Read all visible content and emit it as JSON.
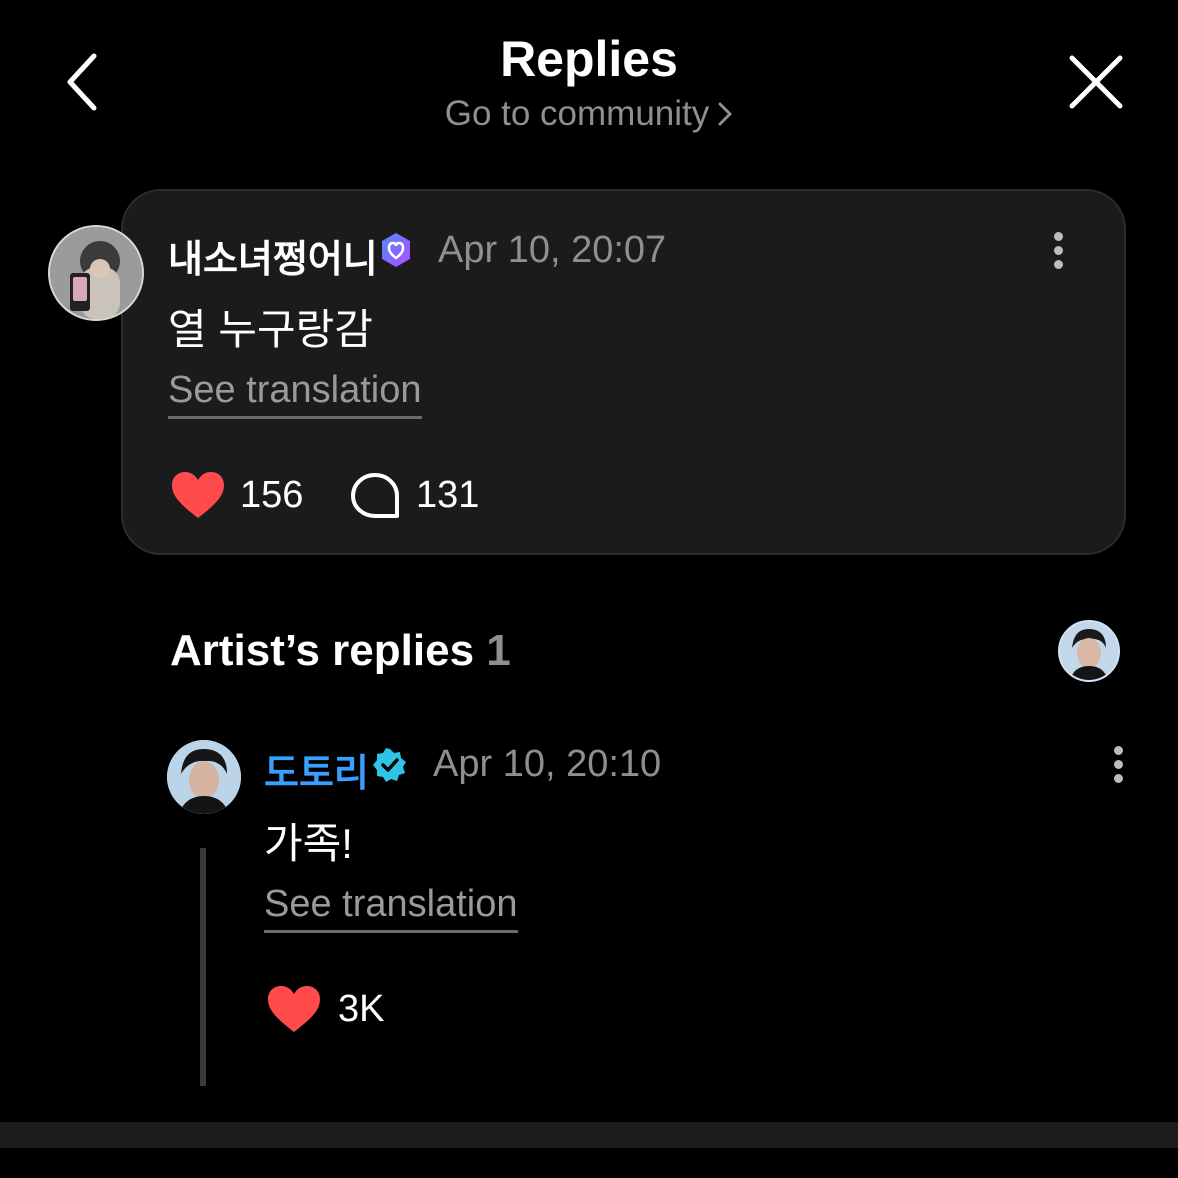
{
  "header": {
    "title": "Replies",
    "community_link": "Go to community"
  },
  "post": {
    "author": "내소녀쩡어니",
    "timestamp": "Apr 10, 20:07",
    "text": "열 누구랑감",
    "translate_label": "See translation",
    "likes": "156",
    "comments": "131"
  },
  "artist_replies": {
    "title": "Artist’s replies",
    "count": "1",
    "reply": {
      "author": "도토리",
      "timestamp": "Apr 10, 20:10",
      "text": "가족!",
      "translate_label": "See translation",
      "likes": "3K"
    }
  },
  "colors": {
    "background": "#000000",
    "card": "#1b1b1c",
    "artist_name": "#3aa0ff",
    "verified_artist": "#2ec4e6",
    "verified_user": "#6c63ff",
    "heart": "#ff4b4b",
    "muted": "#8e8e93"
  },
  "icons": [
    "back-icon",
    "close-icon",
    "chevron-right-icon",
    "verified-badge-icon",
    "more-icon",
    "heart-icon",
    "comment-icon"
  ]
}
